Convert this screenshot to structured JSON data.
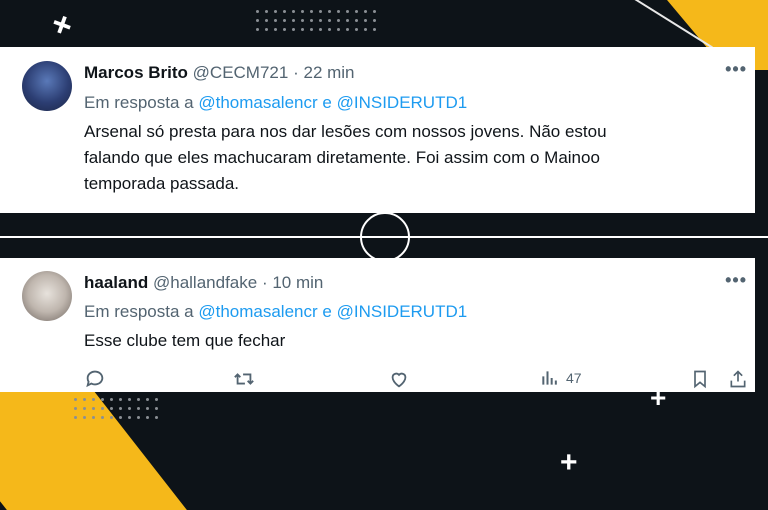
{
  "tweets": [
    {
      "author_name": "Marcos Brito",
      "handle": "@CECM721",
      "sep": "·",
      "time": "22 min",
      "reply_prefix": "Em resposta a",
      "reply_to_1": "@thomasalencr",
      "reply_joiner": "e",
      "reply_to_2": "@INSIDERUTD1",
      "text_lines": [
        "Arsenal só presta para nos dar lesões com nossos jovens. Não estou",
        "falando que eles machucaram diretamente. Foi assim com o Mainoo",
        "temporada passada."
      ],
      "more": "•••"
    },
    {
      "author_name": "haaland",
      "handle": "@hallandfake",
      "sep": "·",
      "time": "10 min",
      "reply_prefix": "Em resposta a",
      "reply_to_1": "@thomasalencr",
      "reply_joiner": "e",
      "reply_to_2": "@INSIDERUTD1",
      "text_lines": [
        "Esse clube tem que fechar"
      ],
      "more": "•••",
      "views": "47"
    }
  ],
  "icons": {
    "reply": "reply-icon",
    "retweet": "retweet-icon",
    "like": "like-icon",
    "views": "views-icon",
    "bookmark": "bookmark-icon",
    "share": "share-icon"
  },
  "colors": {
    "link": "#1d9bf0",
    "muted": "#536471",
    "text": "#0f1419",
    "accent_yellow": "#f5b81a",
    "background": "#0d1318"
  }
}
